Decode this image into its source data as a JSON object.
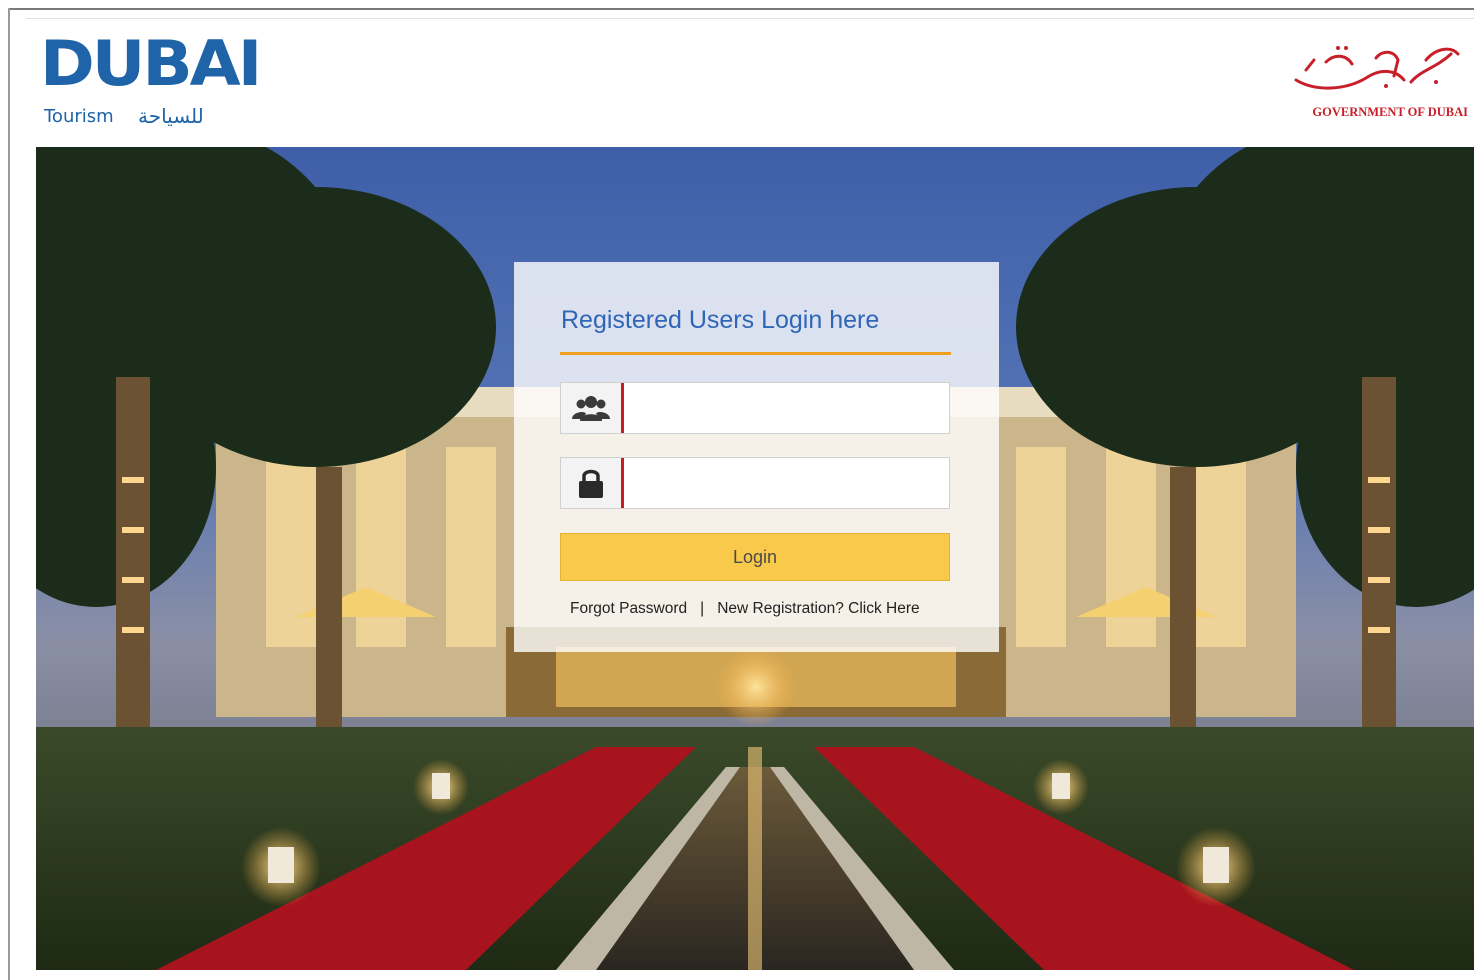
{
  "brand": {
    "logo_word": "DUBAI",
    "logo_tourism": "Tourism",
    "logo_arabic": "للسياحة",
    "gov_text": "GOVERNMENT OF DUBAI",
    "colors": {
      "dubai_blue": "#1f63a8",
      "gov_red": "#c8202a"
    }
  },
  "login": {
    "title": "Registered Users Login here",
    "username_icon": "users-icon",
    "password_icon": "lock-icon",
    "username_value": "",
    "password_value": "",
    "button_label": "Login",
    "forgot_label": "Forgot Password",
    "separator": "|",
    "register_label": "New Registration? Click Here",
    "colors": {
      "title": "#2f66b8",
      "accent_line": "#f0a020",
      "button": "#f8c94a",
      "field_marker": "#cc1b1b"
    }
  }
}
